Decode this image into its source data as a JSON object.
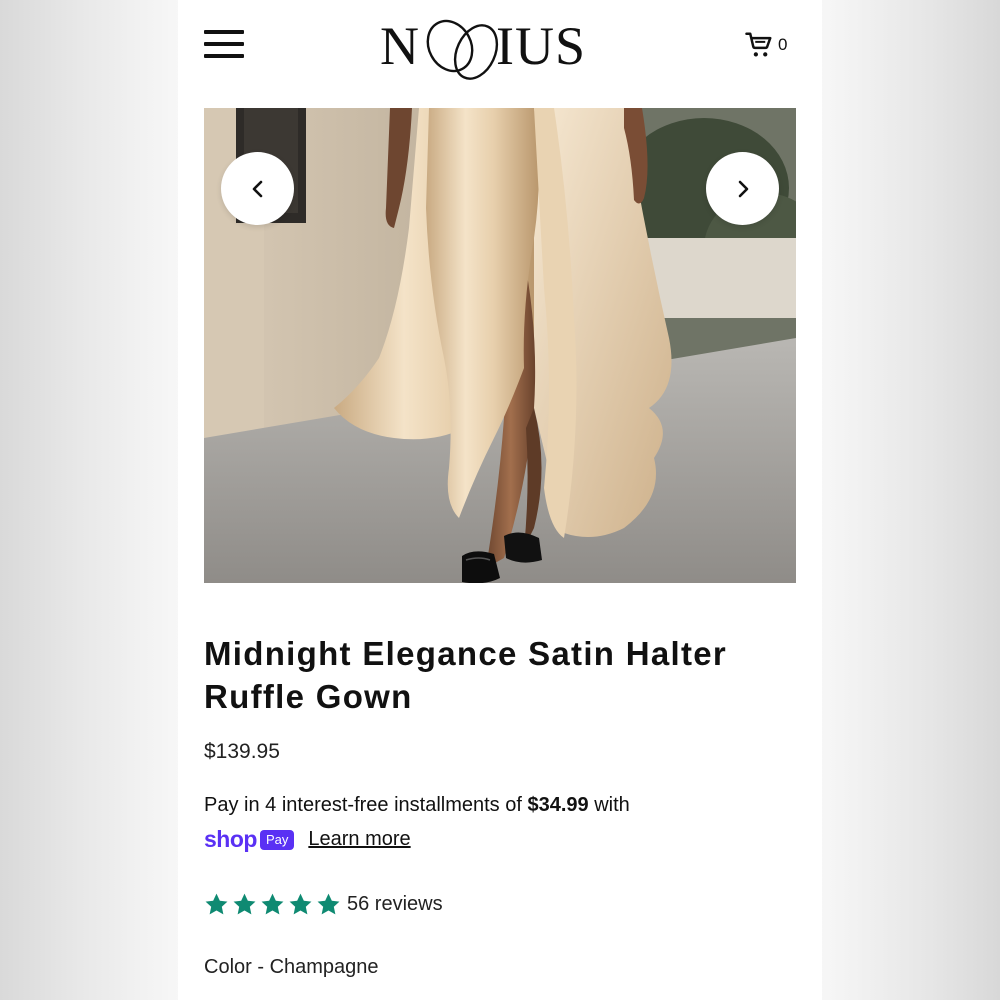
{
  "header": {
    "logo_text": "NOYIUS",
    "cart_count": "0",
    "menu_icon": "hamburger-menu-icon",
    "cart_icon": "shopping-cart-icon"
  },
  "gallery": {
    "prev_icon": "chevron-left-icon",
    "next_icon": "chevron-right-icon"
  },
  "product": {
    "title": "Midnight Elegance Satin Halter Ruffle Gown",
    "price": "$139.95",
    "installments_prefix": "Pay in 4 interest-free installments of ",
    "installments_amount": "$34.99",
    "installments_suffix": " with",
    "shop_word": "shop",
    "pay_badge": "Pay",
    "learn_more": "Learn more",
    "rating_stars": 5,
    "reviews": "56 reviews",
    "color_label": "Color - Champagne"
  },
  "colors": {
    "brand_purple": "#5a31f4",
    "star_green": "#0f8a72",
    "text": "#111111"
  }
}
